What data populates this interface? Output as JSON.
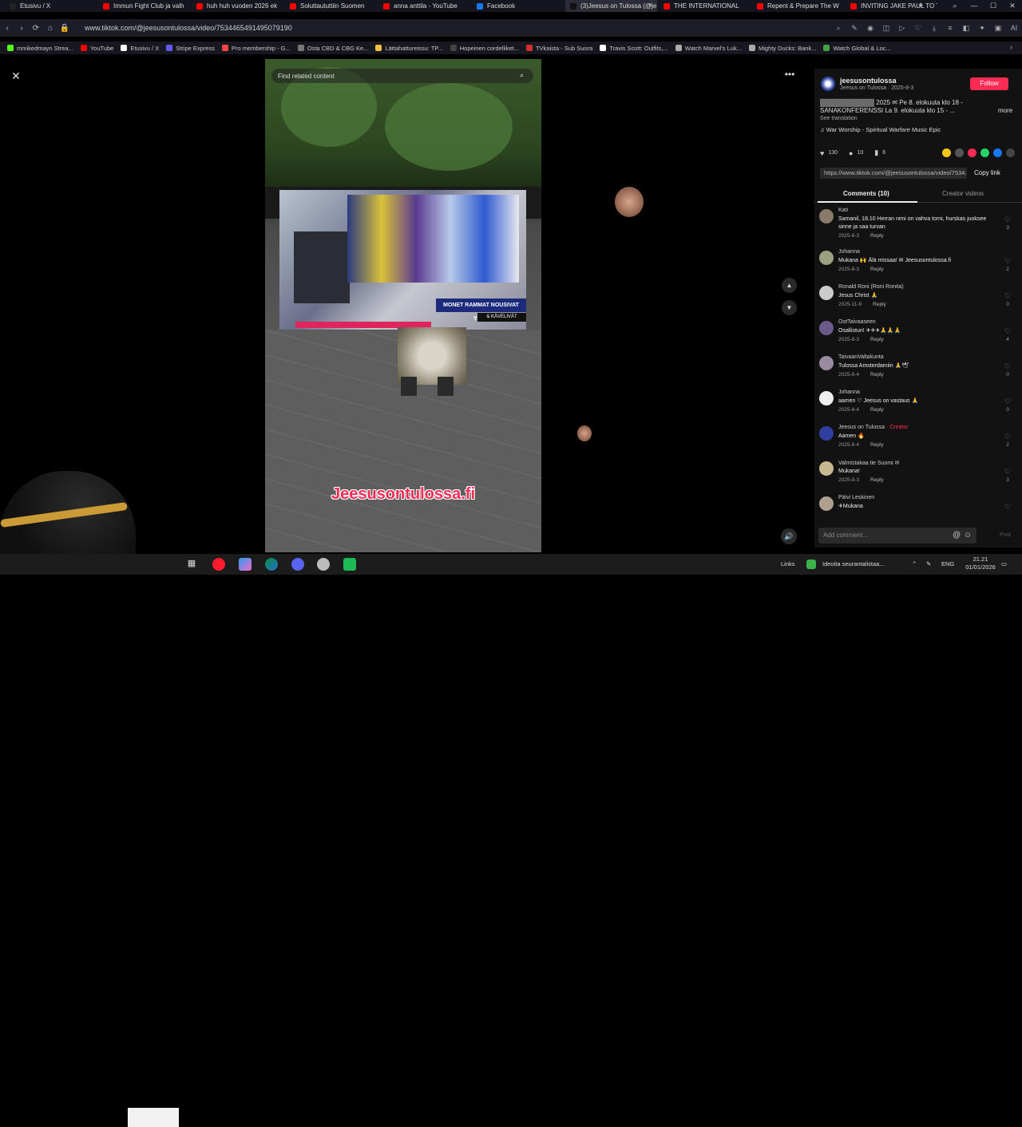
{
  "browser": {
    "tabs": [
      {
        "title": "Etusivu / X",
        "color": "#222222"
      },
      {
        "title": "Immun Fight Club ja valh",
        "color": "#ff0000"
      },
      {
        "title": "huh huh vuoden 2026 ek",
        "color": "#ff0000"
      },
      {
        "title": "Soluttaututtiin Suomen",
        "color": "#ff0000"
      },
      {
        "title": "anna anttila - YouTube",
        "color": "#ff0000"
      },
      {
        "title": "Facebook",
        "color": "#1877f2"
      },
      {
        "title": "(3)Jeesus on Tulossa (@je",
        "color": "#111111",
        "active": true
      },
      {
        "title": "THE INTERNATIONAL",
        "color": "#ff0000"
      },
      {
        "title": "Repent & Prepare The W",
        "color": "#ff0000"
      },
      {
        "title": "INVITING JAKE PAUL TO T",
        "color": "#ff0000"
      }
    ],
    "new_tab": "+",
    "url": "www.tiktok.com/@jeesusontulossa/video/7534465491495079190",
    "bookmarks": [
      {
        "label": "mmikedmayn Strea...",
        "color": "#53fc18"
      },
      {
        "label": "YouTube",
        "color": "#ff0000"
      },
      {
        "label": "Etusivu / X",
        "color": "#ffffff"
      },
      {
        "label": "Stripe Express",
        "color": "#635bff"
      },
      {
        "label": "Pro membership - G...",
        "color": "#ff4444"
      },
      {
        "label": "Osta CBD & CBG Ke...",
        "color": "#777777"
      },
      {
        "label": "Lättahattureissu: TP...",
        "color": "#f0c040"
      },
      {
        "label": "Hopeinen cordelliket...",
        "color": "#444444"
      },
      {
        "label": "TVkaista - Sub Suora",
        "color": "#d32f2f"
      },
      {
        "label": "Travis Scott: Outfits,...",
        "color": "#ffffff"
      },
      {
        "label": "Watch Marvel's Luk...",
        "color": "#aaaaaa"
      },
      {
        "label": "Mighty Ducks: Bank...",
        "color": "#aaaaaa"
      },
      {
        "label": "Watch Global & Loc...",
        "color": "#43a047"
      }
    ]
  },
  "video": {
    "search_placeholder": "Find related content",
    "inset_banner": "MONET RAMMAT NOUSIVAT YLÖS",
    "inset_sub": "& KÄVELIVÄT",
    "watermark": "Jeesusontulossa.fi"
  },
  "panel": {
    "author_name": "jeesusontulossa",
    "author_sub": "Jeesus on Tulossa · 2025-8-3",
    "follow_label": "Follow",
    "caption_tail": "2025 ✉ Pe 8. elokuuta klo 18 - SANAKONFERENSSI La 9. elokuuta klo 15 - ...",
    "more_label": "more",
    "see_translation": "See translation",
    "music": "War Worship - Spiritual Warfare Music Epic",
    "likes": "130",
    "comments_count": "10",
    "saves": "6",
    "link": "https://www.tiktok.com/@jeesusontulossa/video/7534...",
    "copy_label": "Copy link",
    "tab_comments": "Comments (10)",
    "tab_creator": "Creator videos",
    "reply_label": "Reply",
    "creator_label": "· Creator",
    "add_comment": "Add comment...",
    "post_label": "Post",
    "comments": [
      {
        "name": "Kati",
        "text": "Samanil, 18.10 Herran nimi on vahva torni, hurskas juoksee sinne ja saa turvan",
        "date": "2025-8-3",
        "likes": "3",
        "color": "#8a7a6a"
      },
      {
        "name": "Johanna",
        "text": "Mukana 🙌 Älä missaa! ✉ Jeesusontulossa.fi",
        "date": "2025-8-3",
        "likes": "2",
        "color": "#9aa080"
      },
      {
        "name": "Ronald Roni (Roni Ronita)",
        "text": "Jesus Christ 🙏",
        "date": "2025-11-9",
        "likes": "0",
        "color": "#cccccc"
      },
      {
        "name": "OotTaivaaseen",
        "text": "Osallistun! ✈✈✈🙏🙏🙏",
        "date": "2025-8-3",
        "likes": "4",
        "color": "#6a5a8a"
      },
      {
        "name": "TaivaanValtakunta",
        "text": "Tulossa Amsterdamiin 🙏🕊",
        "date": "2025-8-4",
        "likes": "0",
        "color": "#9a8aa0"
      },
      {
        "name": "Johanna",
        "text": "aamen ♡ Jeesus on vastaus 🙏",
        "date": "2025-8-4",
        "likes": "0",
        "color": "#eeeeee"
      },
      {
        "name": "Jeesus on Tulossa",
        "text": "Aamen 🔥",
        "date": "2025-8-4",
        "likes": "2",
        "color": "#2f3fa0",
        "creator": true
      },
      {
        "name": "Valmistakaa tie Suomi ✉",
        "text": "Mukana!",
        "date": "2025-8-3",
        "likes": "3",
        "color": "#c8b890"
      },
      {
        "name": "Päivi Leskinen",
        "text": "✈Mukana",
        "date": "",
        "likes": "",
        "color": "#b0a090"
      }
    ]
  },
  "taskbar": {
    "links": "Links",
    "weather": "Ideoita seurantalistaa...",
    "lang": "ENG",
    "time": "21.21",
    "date": "01/01/2026"
  }
}
